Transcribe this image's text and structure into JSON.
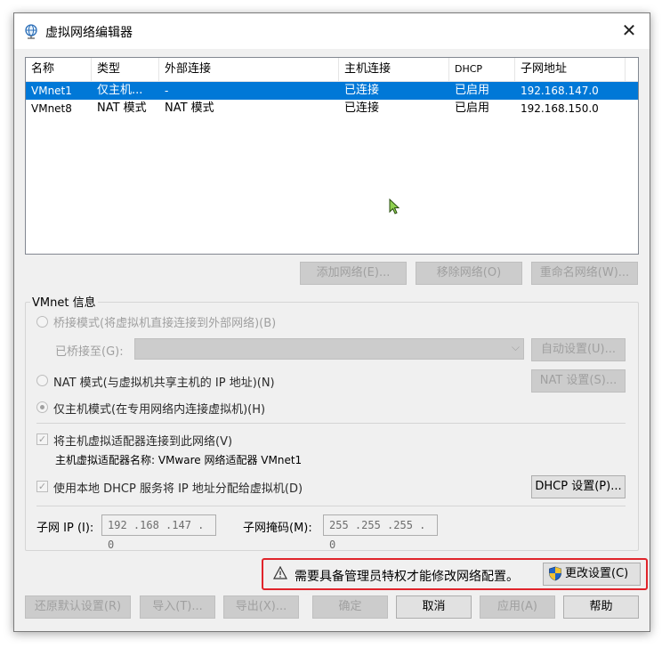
{
  "window": {
    "title": "虚拟网络编辑器",
    "close_label": "✕"
  },
  "table": {
    "columns": [
      "名称",
      "类型",
      "外部连接",
      "主机连接",
      "DHCP",
      "子网地址"
    ],
    "rows": [
      {
        "name": "VMnet1",
        "type": "仅主机...",
        "external": "-",
        "host": "已连接",
        "dhcp": "已启用",
        "subnet": "192.168.147.0",
        "selected": true
      },
      {
        "name": "VMnet8",
        "type": "NAT 模式",
        "external": "NAT 模式",
        "host": "已连接",
        "dhcp": "已启用",
        "subnet": "192.168.150.0",
        "selected": false
      }
    ]
  },
  "network_buttons": {
    "add": "添加网络(E)...",
    "remove": "移除网络(O)",
    "rename": "重命名网络(W)..."
  },
  "vmnet_info": {
    "group_label": "VMnet 信息",
    "bridged_label": "桥接模式(将虚拟机直接连接到外部网络)(B)",
    "bridged_to_label": "已桥接至(G):",
    "auto_settings": "自动设置(U)...",
    "nat_label": "NAT 模式(与虚拟机共享主机的 IP 地址)(N)",
    "nat_settings": "NAT 设置(S)...",
    "hostonly_label": "仅主机模式(在专用网络内连接虚拟机)(H)",
    "connect_adapter_label": "将主机虚拟适配器连接到此网络(V)",
    "adapter_name_label": "主机虚拟适配器名称: VMware 网络适配器 VMnet1",
    "use_dhcp_label": "使用本地 DHCP 服务将 IP 地址分配给虚拟机(D)",
    "dhcp_settings": "DHCP 设置(P)...",
    "subnet_ip_label": "子网 IP (I):",
    "subnet_ip_value": "192 .168 .147 .  0",
    "subnet_mask_label": "子网掩码(M):",
    "subnet_mask_value": "255 .255 .255 .  0"
  },
  "admin_notice": {
    "text": "需要具备管理员特权才能修改网络配置。",
    "change_settings": "更改设置(C)"
  },
  "footer": {
    "restore_defaults": "还原默认设置(R)",
    "import": "导入(T)...",
    "export": "导出(X)...",
    "ok": "确定",
    "cancel": "取消",
    "apply": "应用(A)",
    "help": "帮助"
  },
  "colors": {
    "selection": "#0078d7",
    "warning_border": "#e0242b",
    "dialog_bg": "#f0f0f0"
  },
  "icons": {
    "title_icon": "network-globe-icon",
    "warning": "warning-icon",
    "shield": "uac-shield-icon"
  }
}
